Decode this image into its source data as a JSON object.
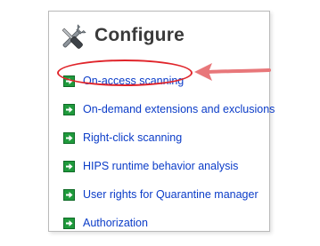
{
  "panel": {
    "title": "Configure",
    "title_icon": "tools-icon",
    "items": [
      {
        "label": "On-access scanning",
        "icon": "green-arrow-icon",
        "highlighted": true
      },
      {
        "label": "On-demand extensions and exclusions",
        "icon": "green-arrow-icon"
      },
      {
        "label": "Right-click scanning",
        "icon": "green-arrow-icon"
      },
      {
        "label": "HIPS runtime behavior analysis",
        "icon": "green-arrow-icon"
      },
      {
        "label": "User rights for Quarantine manager",
        "icon": "green-arrow-icon"
      },
      {
        "label": "Authorization",
        "icon": "green-arrow-icon"
      }
    ]
  },
  "annotation": {
    "highlight_color": "#e0242a",
    "pointer_color": "#e8777a"
  },
  "colors": {
    "link": "#0b3cc8",
    "arrow_icon": "#1f9a3c",
    "title": "#3a3a3a"
  }
}
